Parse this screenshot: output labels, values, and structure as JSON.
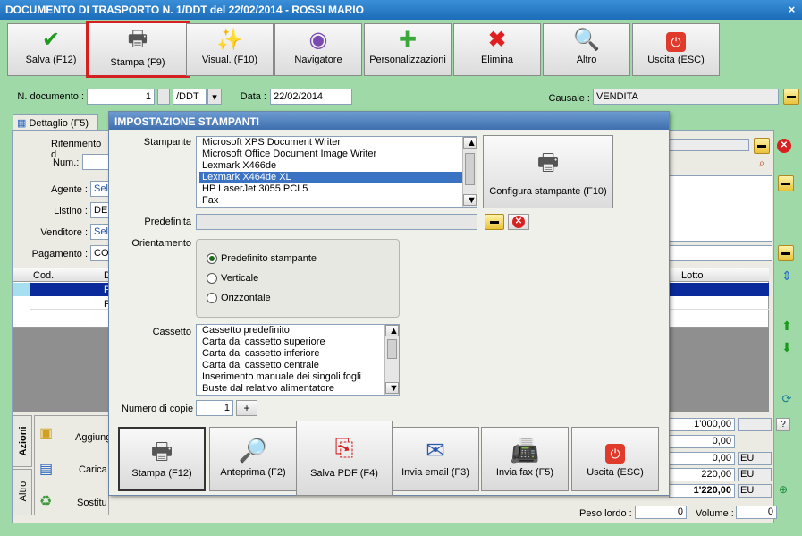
{
  "window": {
    "title": "DOCUMENTO DI TRASPORTO N. 1/DDT del 22/02/2014 - ROSSI MARIO",
    "close": "×"
  },
  "toolbar": [
    {
      "label": "Salva (F12)",
      "icon": "check-icon"
    },
    {
      "label": "Stampa (F9)",
      "icon": "printer-icon"
    },
    {
      "label": "Visual. (F10)",
      "icon": "magic-wand-icon"
    },
    {
      "label": "Navigatore",
      "icon": "compass-icon"
    },
    {
      "label": "Personalizzazioni",
      "icon": "puzzle-icon"
    },
    {
      "label": "Elimina",
      "icon": "x-icon"
    },
    {
      "label": "Altro",
      "icon": "book-magnifier-icon"
    },
    {
      "label": "Uscita (ESC)",
      "icon": "power-icon"
    }
  ],
  "header": {
    "ndoc_label": "N. documento :",
    "ndoc_value": "1",
    "series": "/DDT",
    "data_label": "Data :",
    "data_value": "22/02/2014",
    "causale_label": "Causale :",
    "causale_value": "VENDITA"
  },
  "tab": {
    "label": "Dettaglio (F5)"
  },
  "form": {
    "riferimento_label": "Riferimento d",
    "num_label": "Num.:",
    "agente_label": "Agente :",
    "agente_value": "Sel",
    "listino_label": "Listino :",
    "listino_value": "DE",
    "venditore_label": "Venditore :",
    "venditore_value": "Sel",
    "pagamento_label": "Pagamento :",
    "pagamento_value": "CO"
  },
  "grid": {
    "col_cod": "Cod.",
    "col_d": "D",
    "col_lotto": "Lotto",
    "row1_mark": "P",
    "row2_mark": "P"
  },
  "side_tabs": {
    "azioni": "Azioni",
    "altro": "Altro"
  },
  "actions": [
    {
      "label": "Aggiung"
    },
    {
      "label": "Carica"
    },
    {
      "label": "Sostitu"
    }
  ],
  "totals": {
    "v1": "1'000,00",
    "v2": "0,00",
    "v3": "0,00",
    "v3_cur": "EU",
    "v4": "220,00",
    "v4_cur": "EU",
    "v5": "1'220,00",
    "v5_cur": "EU",
    "help": "?",
    "peso_label": "Peso lordo :",
    "peso_value": "0",
    "volume_label": "Volume :",
    "volume_value": "0"
  },
  "dialog": {
    "title": "IMPOSTAZIONE STAMPANTI",
    "stampante_label": "Stampante",
    "printers": [
      "Microsoft XPS Document Writer",
      "Microsoft Office Document Image Writer",
      "Lexmark X466de",
      "Lexmark X464de XL",
      "HP LaserJet 3055 PCL5",
      "Fax"
    ],
    "selected_printer": "Lexmark X464de XL",
    "configure_label": "Configura stampante (F10)",
    "predefinita_label": "Predefinita",
    "orientamento_label": "Orientamento",
    "orient": [
      "Predefinito stampante",
      "Verticale",
      "Orizzontale"
    ],
    "cassetto_label": "Cassetto",
    "trays": [
      "Cassetto predefinito",
      "Carta dal cassetto superiore",
      "Carta dal cassetto inferiore",
      "Carta dal cassetto centrale",
      "Inserimento manuale dei singoli fogli",
      "Buste dal relativo alimentatore"
    ],
    "copie_label": "Numero di copie",
    "copie_value": "1",
    "copie_plus": "+",
    "buttons": [
      {
        "label": "Stampa (F12)",
        "icon": "printer-icon"
      },
      {
        "label": "Anteprima (F2)",
        "icon": "preview-icon"
      },
      {
        "label": "Salva PDF (F4)",
        "icon": "pdf-icon"
      },
      {
        "label": "Invia email (F3)",
        "icon": "email-icon"
      },
      {
        "label": "Invia fax (F5)",
        "icon": "fax-icon"
      },
      {
        "label": "Uscita (ESC)",
        "icon": "power-icon"
      }
    ]
  }
}
